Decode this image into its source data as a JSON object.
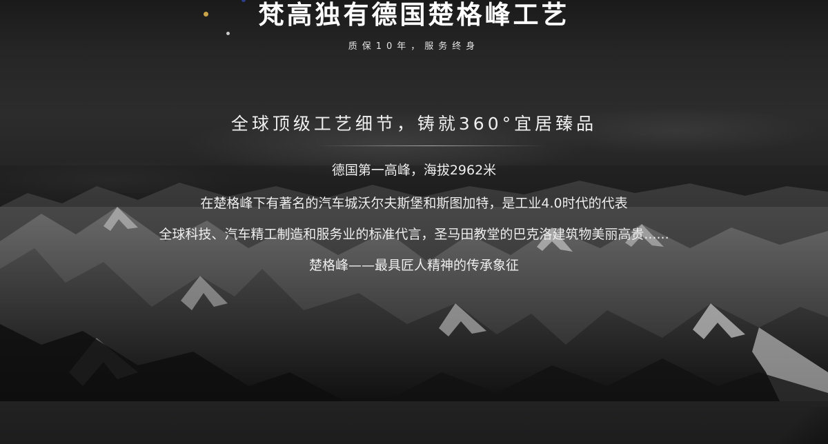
{
  "header": {
    "title": "梵高独有德国楚格峰工艺",
    "subtitle": "质保10年，服务终身"
  },
  "main": {
    "headline": "全球顶级工艺细节，铸就360°宜居臻品",
    "lines": [
      "德国第一高峰，海拔2962米",
      "在楚格峰下有著名的汽车城沃尔夫斯堡和斯图加特，是工业4.0时代的代表",
      "全球科技、汽车精工制造和服务业的标准代言，圣马田教堂的巴克洛建筑物美丽高贵......",
      "楚格峰——最具匠人精神的传承象征"
    ]
  },
  "decor": {
    "dot_colors": [
      "#c9a34a",
      "#c9c9c9",
      "#2d3f8c"
    ]
  }
}
